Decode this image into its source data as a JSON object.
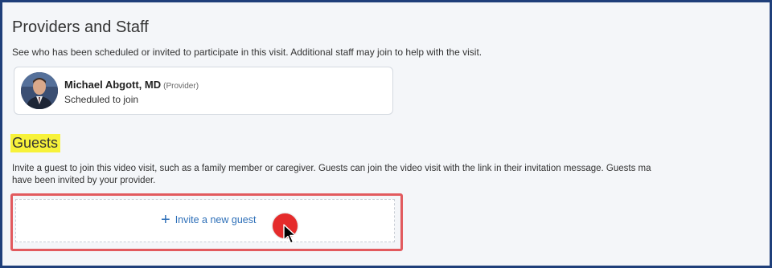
{
  "providers_section": {
    "title": "Providers and Staff",
    "description": "See who has been scheduled or invited to participate in this visit. Additional staff may join to help with the visit."
  },
  "provider": {
    "name": "Michael Abgott, MD",
    "role": "(Provider)",
    "status": "Scheduled to join"
  },
  "guests_section": {
    "title": "Guests",
    "description_line1": "Invite a guest to join this video visit, such as a family member or caregiver. Guests can join the video visit with the link in their invitation message. Guests ma",
    "description_line2": "have been invited by your provider."
  },
  "invite": {
    "icon": "plus-icon",
    "label": "Invite a new guest"
  },
  "colors": {
    "frame_border": "#1f3f7a",
    "link_blue": "#2d6fb8",
    "highlight_yellow": "#f7f23a",
    "annotation_red": "#e25a5e"
  }
}
